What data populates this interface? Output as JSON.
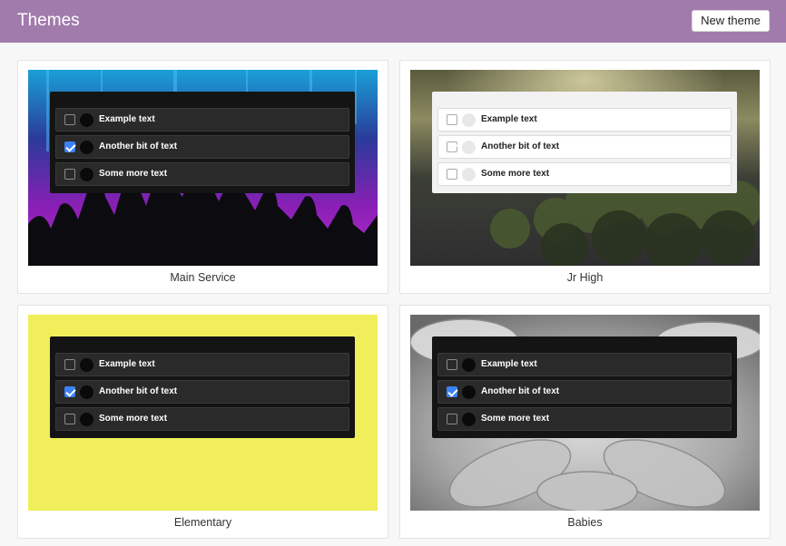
{
  "header": {
    "title": "Themes",
    "new_theme_label": "New theme"
  },
  "sample_items": [
    {
      "label": "Example text",
      "checked": false
    },
    {
      "label": "Another bit of text",
      "checked": true
    },
    {
      "label": "Some more text",
      "checked": false
    }
  ],
  "themes": [
    {
      "name": "Main Service",
      "style": "dark",
      "background": "concert-crowd-purple"
    },
    {
      "name": "Jr High",
      "style": "light",
      "background": "misty-forest"
    },
    {
      "name": "Elementary",
      "style": "dark",
      "background": "solid-yellow"
    },
    {
      "name": "Babies",
      "style": "dark",
      "background": "baby-hands-grayscale"
    }
  ],
  "colors": {
    "header_bg": "#a27bad",
    "yellow_bg": "#f0ee5a",
    "checkbox_accent": "#3b82f6"
  }
}
